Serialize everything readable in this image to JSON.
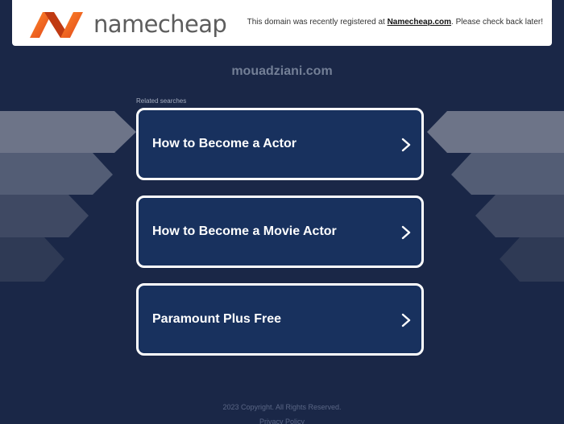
{
  "header": {
    "brand": "namecheap",
    "notice_prefix": "This domain was recently registered at ",
    "notice_link": "Namecheap.com",
    "notice_suffix": ". Please check back later!"
  },
  "domain": "mouadziani.com",
  "related_label": "Related searches",
  "searches": [
    {
      "label": "How to Become a Actor"
    },
    {
      "label": "How to Become a Movie Actor"
    },
    {
      "label": "Paramount Plus Free"
    }
  ],
  "footer": {
    "copyright": "2023 Copyright. All Rights Reserved.",
    "privacy": "Privacy Policy"
  },
  "colors": {
    "background": "#1a2747",
    "card": "#18315e",
    "brand_orange": "#f25a1a"
  }
}
